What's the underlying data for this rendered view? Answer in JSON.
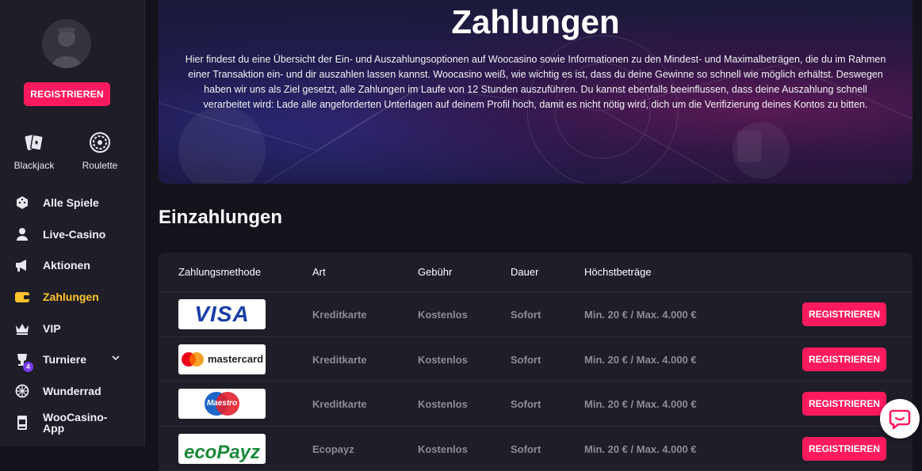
{
  "sidebar": {
    "register_label": "REGISTRIEREN",
    "quick_links": [
      {
        "label": "Blackjack",
        "icon": "cards-icon"
      },
      {
        "label": "Roulette",
        "icon": "roulette-icon"
      }
    ],
    "nav": [
      {
        "label": "Alle Spiele",
        "icon": "dice-icon"
      },
      {
        "label": "Live-Casino",
        "icon": "dealer-icon"
      },
      {
        "label": "Aktionen",
        "icon": "megaphone-icon"
      },
      {
        "label": "Zahlungen",
        "icon": "wallet-icon"
      },
      {
        "label": "VIP",
        "icon": "crown-icon"
      },
      {
        "label": "Turniere",
        "icon": "trophy-icon",
        "badge": "4"
      },
      {
        "label": "Wunderrad",
        "icon": "wheel-icon"
      },
      {
        "label": "WooCasino-\nApp",
        "icon": "app-icon"
      }
    ],
    "active_color": "#ffc42b"
  },
  "hero": {
    "title": "Zahlungen",
    "text": "Hier findest du eine Übersicht der Ein- und Auszahlungsoptionen auf Woocasino sowie Informationen zu den Mindest- und Maximalbeträgen, die du im Rahmen einer Transaktion ein- und dir auszahlen lassen kannst. Woocasino weiß, wie wichtig es ist, dass du deine Gewinne so schnell wie möglich erhältst. Deswegen haben wir uns als Ziel gesetzt, alle Zahlungen im Laufe von 12 Stunden auszuführen. Du kannst ebenfalls beeinflussen, dass deine Auszahlung schnell verarbeitet wird: Lade alle angeforderten Unterlagen auf deinem Profil hoch, damit es nicht nötig wird, dich um die Verifizierung deines Kontos zu bitten."
  },
  "deposits": {
    "title": "Einzahlungen",
    "columns": [
      "Zahlungsmethode",
      "Art",
      "Gebühr",
      "Dauer",
      "Höchstbeträge"
    ],
    "rows": [
      {
        "logo": "VISA",
        "type": "Kreditkarte",
        "fee": "Kostenlos",
        "time": "Sofort",
        "limits": "Min. 20 € / Max. 4.000 €",
        "button": "REGISTRIEREN"
      },
      {
        "logo": "mastercard",
        "type": "Kreditkarte",
        "fee": "Kostenlos",
        "time": "Sofort",
        "limits": "Min. 20 € / Max. 4.000 €",
        "button": "REGISTRIEREN"
      },
      {
        "logo": "Maestro",
        "type": "Kreditkarte",
        "fee": "Kostenlos",
        "time": "Sofort",
        "limits": "Min. 20 € / Max. 4.000 €",
        "button": "REGISTRIEREN"
      },
      {
        "logo": "ecoPayz",
        "type": "Ecopayz",
        "fee": "Kostenlos",
        "time": "Sofort",
        "limits": "Min. 20 € / Max. 4.000 €",
        "button": "REGISTRIEREN"
      }
    ]
  },
  "colors": {
    "accent": "#ff1a5e",
    "sidebar_bg": "#1f1e28",
    "page_bg": "#14131c"
  }
}
